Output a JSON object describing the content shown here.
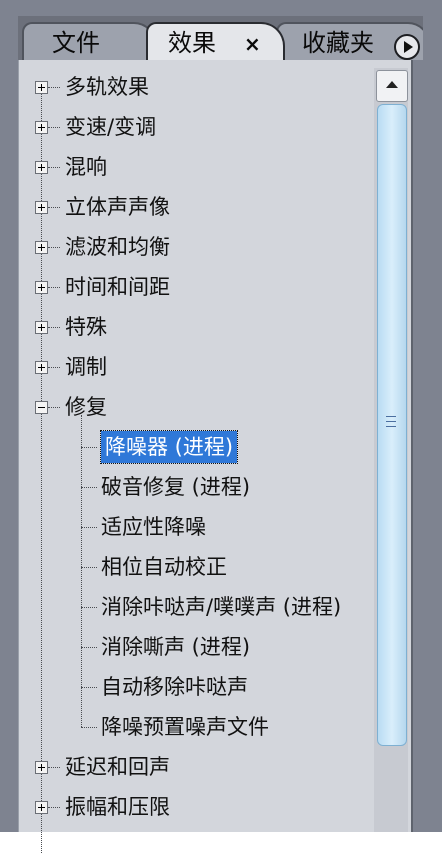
{
  "tabs": [
    {
      "label": "文件",
      "active": false
    },
    {
      "label": "效果",
      "active": true,
      "close_label": "×"
    },
    {
      "label": "收藏夹",
      "active": false
    }
  ],
  "tree": {
    "items": [
      {
        "label": "多轨效果",
        "expanded": false
      },
      {
        "label": "变速/变调",
        "expanded": false
      },
      {
        "label": "混响",
        "expanded": false
      },
      {
        "label": "立体声声像",
        "expanded": false
      },
      {
        "label": "滤波和均衡",
        "expanded": false
      },
      {
        "label": "时间和间距",
        "expanded": false
      },
      {
        "label": "特殊",
        "expanded": false
      },
      {
        "label": "调制",
        "expanded": false
      },
      {
        "label": "修复",
        "expanded": true,
        "children": [
          {
            "label": "降噪器 (进程)",
            "selected": true
          },
          {
            "label": "破音修复 (进程)"
          },
          {
            "label": "适应性降噪"
          },
          {
            "label": "相位自动校正"
          },
          {
            "label": "消除咔哒声/噗噗声 (进程)"
          },
          {
            "label": "消除嘶声 (进程)"
          },
          {
            "label": "自动移除咔哒声"
          },
          {
            "label": "降噪预置噪声文件"
          }
        ]
      },
      {
        "label": "延迟和回声",
        "expanded": false
      },
      {
        "label": "振幅和压限",
        "expanded": false
      }
    ]
  },
  "colors": {
    "selection": "#2f78d8",
    "panel_bg": "#d3d6dc",
    "scroll_thumb": "#cde7f8"
  }
}
